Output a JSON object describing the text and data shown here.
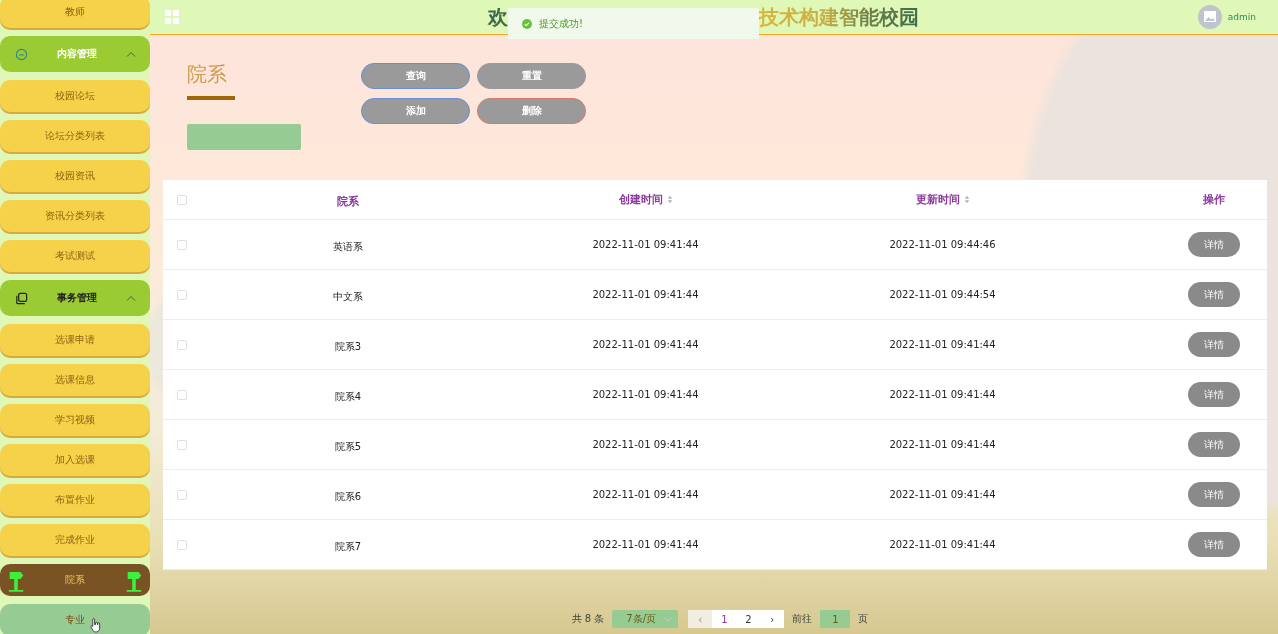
{
  "header": {
    "title_start": "欢",
    "title_end": "技术构建智能校园",
    "user": "admin"
  },
  "toast": {
    "message": "提交成功!"
  },
  "sidebar": {
    "items": [
      {
        "kind": "item",
        "label": "教师",
        "selected": false,
        "hovered": false
      },
      {
        "kind": "group",
        "label": "内容管理",
        "expanded": true
      },
      {
        "kind": "item",
        "label": "校园论坛",
        "selected": false,
        "hovered": false
      },
      {
        "kind": "item",
        "label": "论坛分类列表",
        "selected": false,
        "hovered": false
      },
      {
        "kind": "item",
        "label": "校园资讯",
        "selected": false,
        "hovered": false
      },
      {
        "kind": "item",
        "label": "资讯分类列表",
        "selected": false,
        "hovered": false
      },
      {
        "kind": "item",
        "label": "考试测试",
        "selected": false,
        "hovered": false
      },
      {
        "kind": "group",
        "label": "事务管理",
        "expanded": true
      },
      {
        "kind": "item",
        "label": "选课申请",
        "selected": false,
        "hovered": false
      },
      {
        "kind": "item",
        "label": "选课信息",
        "selected": false,
        "hovered": false
      },
      {
        "kind": "item",
        "label": "学习视频",
        "selected": false,
        "hovered": false
      },
      {
        "kind": "item",
        "label": "加入选课",
        "selected": false,
        "hovered": false
      },
      {
        "kind": "item",
        "label": "布置作业",
        "selected": false,
        "hovered": false
      },
      {
        "kind": "item",
        "label": "完成作业",
        "selected": false,
        "hovered": false
      },
      {
        "kind": "item",
        "label": "院系",
        "selected": true,
        "hovered": false
      },
      {
        "kind": "item",
        "label": "专业",
        "selected": false,
        "hovered": true
      }
    ]
  },
  "page": {
    "title": "院系",
    "buttons": [
      {
        "label": "查询",
        "kind": "primary"
      },
      {
        "label": "重置",
        "kind": "plain"
      },
      {
        "label": "添加",
        "kind": "primary"
      },
      {
        "label": "删除",
        "kind": "danger"
      }
    ]
  },
  "table": {
    "columns": [
      {
        "label": "院系",
        "sortable": false
      },
      {
        "label": "创建时间",
        "sortable": true
      },
      {
        "label": "更新时间",
        "sortable": true
      },
      {
        "label": "操作",
        "sortable": false
      }
    ],
    "all_checked": false,
    "rows": [
      {
        "checked": false,
        "name": "英语系",
        "created": "2022-11-01 09:41:44",
        "updated": "2022-11-01 09:44:46",
        "action": "详情"
      },
      {
        "checked": false,
        "name": "中文系",
        "created": "2022-11-01 09:41:44",
        "updated": "2022-11-01 09:44:54",
        "action": "详情"
      },
      {
        "checked": false,
        "name": "院系3",
        "created": "2022-11-01 09:41:44",
        "updated": "2022-11-01 09:41:44",
        "action": "详情"
      },
      {
        "checked": false,
        "name": "院系4",
        "created": "2022-11-01 09:41:44",
        "updated": "2022-11-01 09:41:44",
        "action": "详情"
      },
      {
        "checked": false,
        "name": "院系5",
        "created": "2022-11-01 09:41:44",
        "updated": "2022-11-01 09:41:44",
        "action": "详情"
      },
      {
        "checked": false,
        "name": "院系6",
        "created": "2022-11-01 09:41:44",
        "updated": "2022-11-01 09:41:44",
        "action": "详情"
      },
      {
        "checked": false,
        "name": "院系7",
        "created": "2022-11-01 09:41:44",
        "updated": "2022-11-01 09:41:44",
        "action": "详情"
      }
    ]
  },
  "pagination": {
    "total": "共 8 条",
    "page_size": "7条/页",
    "prev": "‹",
    "pages": [
      {
        "label": "1",
        "selected": true
      },
      {
        "label": "2",
        "selected": false
      }
    ],
    "next": "›",
    "goto": "前往",
    "goto_value": "1",
    "page_unit": "页"
  }
}
